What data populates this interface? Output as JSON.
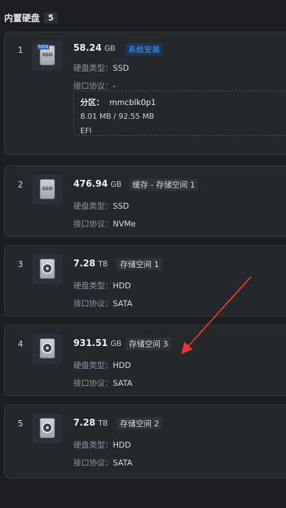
{
  "header": {
    "title": "内置硬盘",
    "count": "5"
  },
  "labels": {
    "type": "硬盘类型：",
    "interface": "接口协议："
  },
  "disks": [
    {
      "index": "1",
      "size": "58.24",
      "unit": "GB",
      "tag": "系统安装",
      "icon": "ssd-fnos-drive-icon",
      "type": "SSD",
      "interface": "-",
      "partition": {
        "label": "分区：",
        "name": "mmcblk0p1",
        "usage": "8.01 MB / 92.55 MB",
        "fs": "EFI"
      }
    },
    {
      "index": "2",
      "size": "476.94",
      "unit": "GB",
      "tag": "缓存 - 存储空间 1",
      "icon": "ssd-drive-icon",
      "type": "SSD",
      "interface": "NVMe"
    },
    {
      "index": "3",
      "size": "7.28",
      "unit": "TB",
      "tag": "存储空间 1",
      "icon": "hdd-drive-icon",
      "type": "HDD",
      "interface": "SATA"
    },
    {
      "index": "4",
      "size": "931.51",
      "unit": "GB",
      "tag": "存储空间 3",
      "icon": "hdd-drive-icon",
      "type": "HDD",
      "interface": "SATA"
    },
    {
      "index": "5",
      "size": "7.28",
      "unit": "TB",
      "tag": "存储空间 2",
      "icon": "hdd-drive-icon",
      "type": "HDD",
      "interface": "SATA"
    }
  ],
  "colors": {
    "accent": "#4a9cf0",
    "annotation": "#e23b2e"
  }
}
